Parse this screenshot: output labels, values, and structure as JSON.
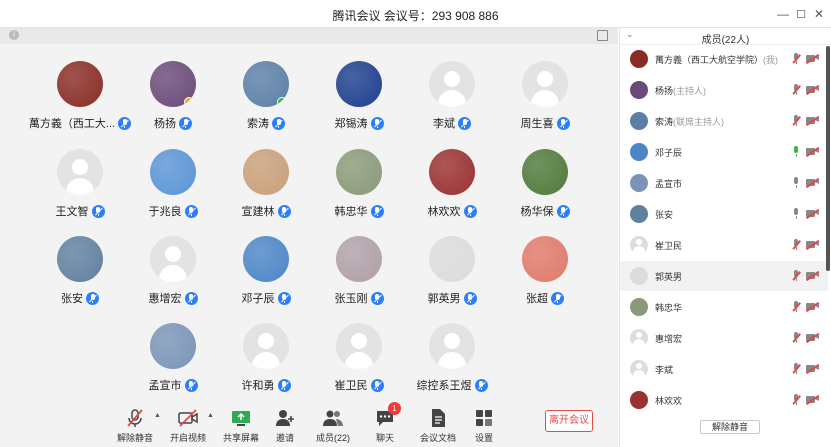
{
  "window": {
    "title": "腾讯会议  会议号：293 908 886",
    "minimize": "—",
    "maximize": "☐",
    "close": "✕"
  },
  "grid": [
    {
      "name": "萬方義（西工大...",
      "avatar": "img",
      "color": "#8a2c25"
    },
    {
      "name": "杨扬",
      "avatar": "img",
      "color": "#6a4a7a",
      "badge": "#f5a623"
    },
    {
      "name": "索涛",
      "avatar": "img",
      "color": "#5c7fa8",
      "badge": "#3bb54a"
    },
    {
      "name": "郑锡涛",
      "avatar": "img",
      "color": "#1e3f8f"
    },
    {
      "name": "李斌",
      "avatar": "placeholder"
    },
    {
      "name": "周生喜",
      "avatar": "placeholder"
    },
    {
      "name": "王文智",
      "avatar": "placeholder"
    },
    {
      "name": "于兆良",
      "avatar": "img",
      "color": "#5a95d6"
    },
    {
      "name": "宣建林",
      "avatar": "img",
      "color": "#c9a07a"
    },
    {
      "name": "韩忠华",
      "avatar": "img",
      "color": "#8a9a78"
    },
    {
      "name": "林欢欢",
      "avatar": "img",
      "color": "#9a3030"
    },
    {
      "name": "杨华保",
      "avatar": "img",
      "color": "#4f7a3a"
    },
    {
      "name": "张安",
      "avatar": "img",
      "color": "#6080a0"
    },
    {
      "name": "惠增宏",
      "avatar": "placeholder"
    },
    {
      "name": "邓子辰",
      "avatar": "img",
      "color": "#4c86c7"
    },
    {
      "name": "张玉刚",
      "avatar": "img",
      "color": "#b0a0a8"
    },
    {
      "name": "郭英男",
      "avatar": "img",
      "color": "#dcdcdc"
    },
    {
      "name": "张超",
      "avatar": "img",
      "color": "#e07a6a"
    },
    {
      "name": "孟宣市",
      "avatar": "img",
      "color": "#7a94b8"
    },
    {
      "name": "许和勇",
      "avatar": "placeholder"
    },
    {
      "name": "崔卫民",
      "avatar": "placeholder"
    },
    {
      "name": "综控系王煜",
      "avatar": "placeholder"
    }
  ],
  "toolbar": {
    "mute_label": "解除静音",
    "video_label": "开启视频",
    "share_label": "共享屏幕",
    "invite_label": "邀请",
    "members_label": "成员(22)",
    "chat_label": "聊天",
    "chat_badge": "1",
    "docs_label": "会议文档",
    "settings_label": "设置",
    "leave_label": "离开会议"
  },
  "panel": {
    "title": "成员(22人)",
    "unmute_all": "解除静音",
    "members": [
      {
        "name": "萬方義（西工大航空学院）",
        "role": "(我)",
        "avatar": "img",
        "color": "#8a2c25",
        "mic": "off"
      },
      {
        "name": "杨扬",
        "role": "(主持人)",
        "avatar": "img",
        "color": "#6a4a7a",
        "mic": "off"
      },
      {
        "name": "索涛",
        "role": "(联席主持人)",
        "avatar": "img",
        "color": "#5c7fa8",
        "mic": "off"
      },
      {
        "name": "邓子辰",
        "role": "",
        "avatar": "img",
        "color": "#4c86c7",
        "mic": "on"
      },
      {
        "name": "孟宣市",
        "role": "",
        "avatar": "img",
        "color": "#7a94b8",
        "mic": "idle"
      },
      {
        "name": "张安",
        "role": "",
        "avatar": "img",
        "color": "#6080a0",
        "mic": "idle"
      },
      {
        "name": "崔卫民",
        "role": "",
        "avatar": "placeholder",
        "mic": "off"
      },
      {
        "name": "郭英男",
        "role": "",
        "avatar": "img",
        "color": "#dcdcdc",
        "mic": "off"
      },
      {
        "name": "韩忠华",
        "role": "",
        "avatar": "img",
        "color": "#8a9a78",
        "mic": "off"
      },
      {
        "name": "惠增宏",
        "role": "",
        "avatar": "placeholder",
        "mic": "off"
      },
      {
        "name": "李斌",
        "role": "",
        "avatar": "placeholder",
        "mic": "off"
      },
      {
        "name": "林欢欢",
        "role": "",
        "avatar": "img",
        "color": "#9a3030",
        "mic": "off"
      }
    ]
  }
}
